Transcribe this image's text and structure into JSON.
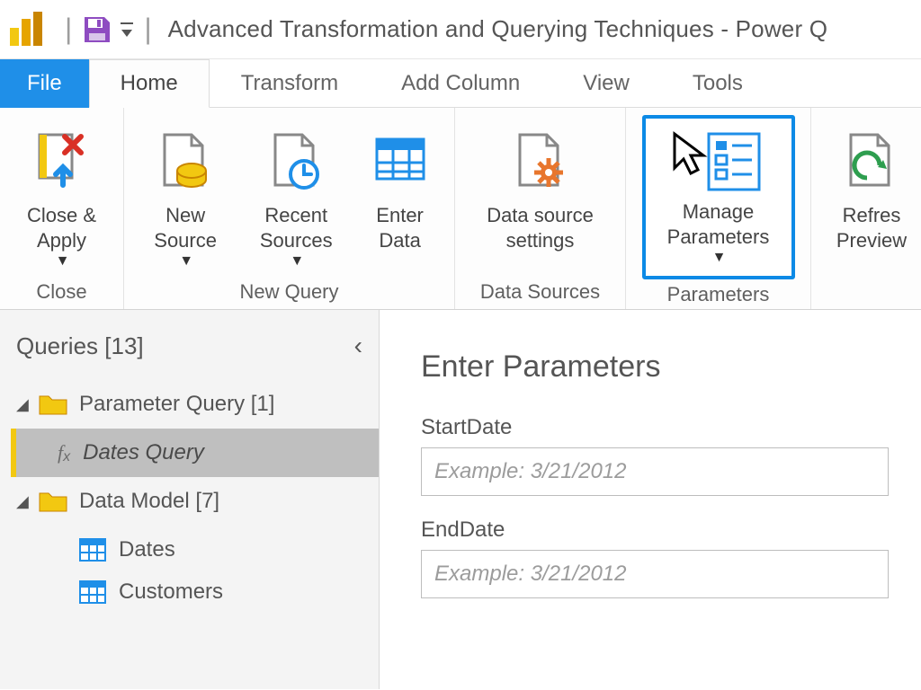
{
  "titlebar": {
    "title": "Advanced Transformation and Querying Techniques - Power Q"
  },
  "tabs": {
    "file": "File",
    "home": "Home",
    "transform": "Transform",
    "addcolumn": "Add Column",
    "view": "View",
    "tools": "Tools"
  },
  "ribbon": {
    "close": {
      "close_apply": "Close &\nApply",
      "group_label": "Close"
    },
    "newquery": {
      "new_source": "New\nSource",
      "recent_sources": "Recent\nSources",
      "enter_data": "Enter\nData",
      "group_label": "New Query"
    },
    "datasources": {
      "data_source_settings": "Data source\nsettings",
      "group_label": "Data Sources"
    },
    "parameters": {
      "manage_parameters": "Manage\nParameters",
      "group_label": "Parameters"
    },
    "refresh": {
      "refresh_preview": "Refres\nPreview"
    }
  },
  "queries": {
    "header": "Queries [13]",
    "parameter_group": "Parameter Query [1]",
    "dates_query": "Dates Query",
    "data_model_group": "Data Model [7]",
    "dates_table": "Dates",
    "customers_table": "Customers"
  },
  "params_form": {
    "title": "Enter Parameters",
    "startdate_label": "StartDate",
    "startdate_placeholder": "Example: 3/21/2012",
    "enddate_label": "EndDate",
    "enddate_placeholder": "Example: 3/21/2012"
  }
}
